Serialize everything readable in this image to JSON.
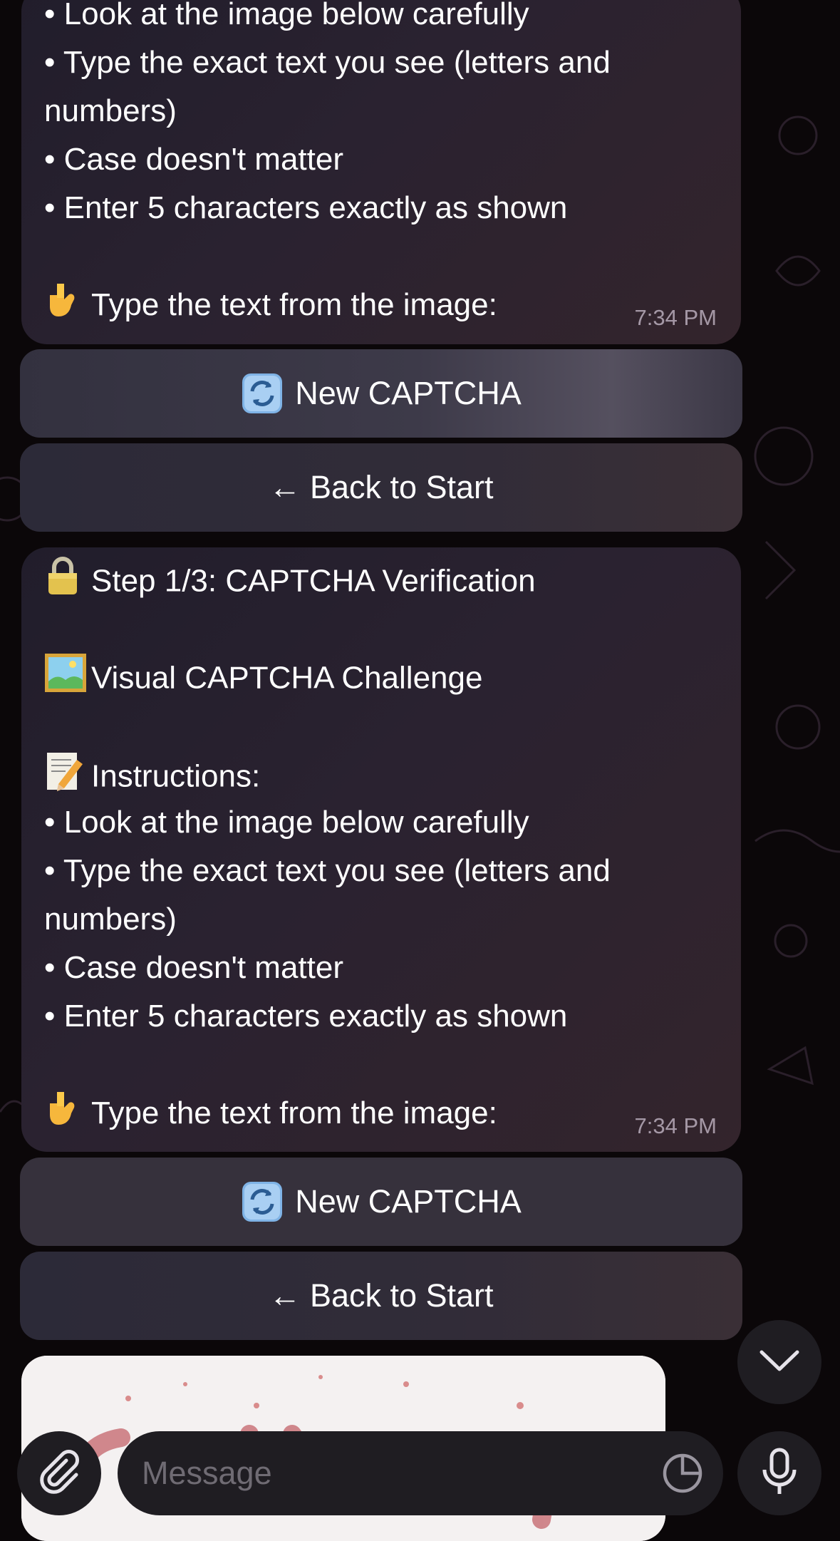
{
  "messages": [
    {
      "lines": [
        "• Look at the image below carefully",
        "• Type the exact text you see (letters and",
        "numbers)",
        "• Case doesn't matter",
        "• Enter 5 characters exactly as shown",
        "Type the text from the image:"
      ],
      "time": "7:34 PM"
    },
    {
      "step": "Step 1/3: CAPTCHA Verification",
      "challenge": "Visual CAPTCHA Challenge",
      "instructions_label": "Instructions:",
      "lines": [
        "• Look at the image below carefully",
        "• Type the exact text you see (letters and",
        "numbers)",
        "• Case doesn't matter",
        "• Enter 5 characters exactly as shown",
        "Type the text from the image:"
      ],
      "time": "7:34 PM"
    }
  ],
  "buttons": {
    "new_captcha": "New CAPTCHA",
    "back_to_start": "← Back to Start"
  },
  "composer": {
    "placeholder": "Message"
  },
  "icons": {
    "refresh": "refresh-icon",
    "lock": "lock-icon",
    "picture": "picture-icon",
    "memo": "memo-icon",
    "pointing_down": "pointing-down-icon",
    "attach": "paperclip-icon",
    "sticker": "sticker-icon",
    "mic": "microphone-icon",
    "scroll_down": "chevron-down-icon"
  },
  "colors": {
    "background": "#0b0709",
    "bubble": "#2a2230",
    "button": "#3d3a49"
  }
}
